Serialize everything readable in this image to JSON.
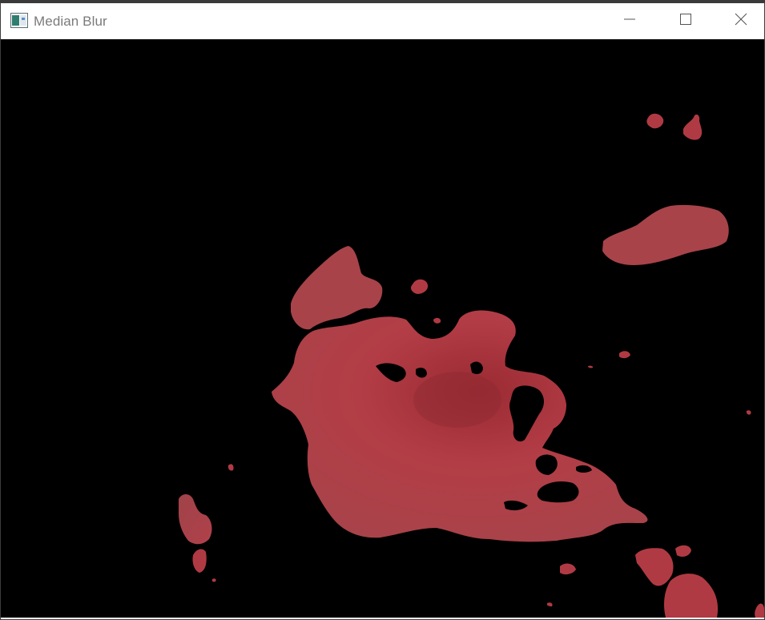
{
  "window": {
    "title": "Median Blur",
    "icons": {
      "app": "app-window-icon",
      "minimize": "minimize-icon",
      "maximize": "maximize-icon",
      "close": "close-icon"
    }
  },
  "canvas": {
    "background": "#000000",
    "blob_color": "#b03a43",
    "blob_shadow": "#8f2a32",
    "title_color": "#7a7a7a"
  }
}
